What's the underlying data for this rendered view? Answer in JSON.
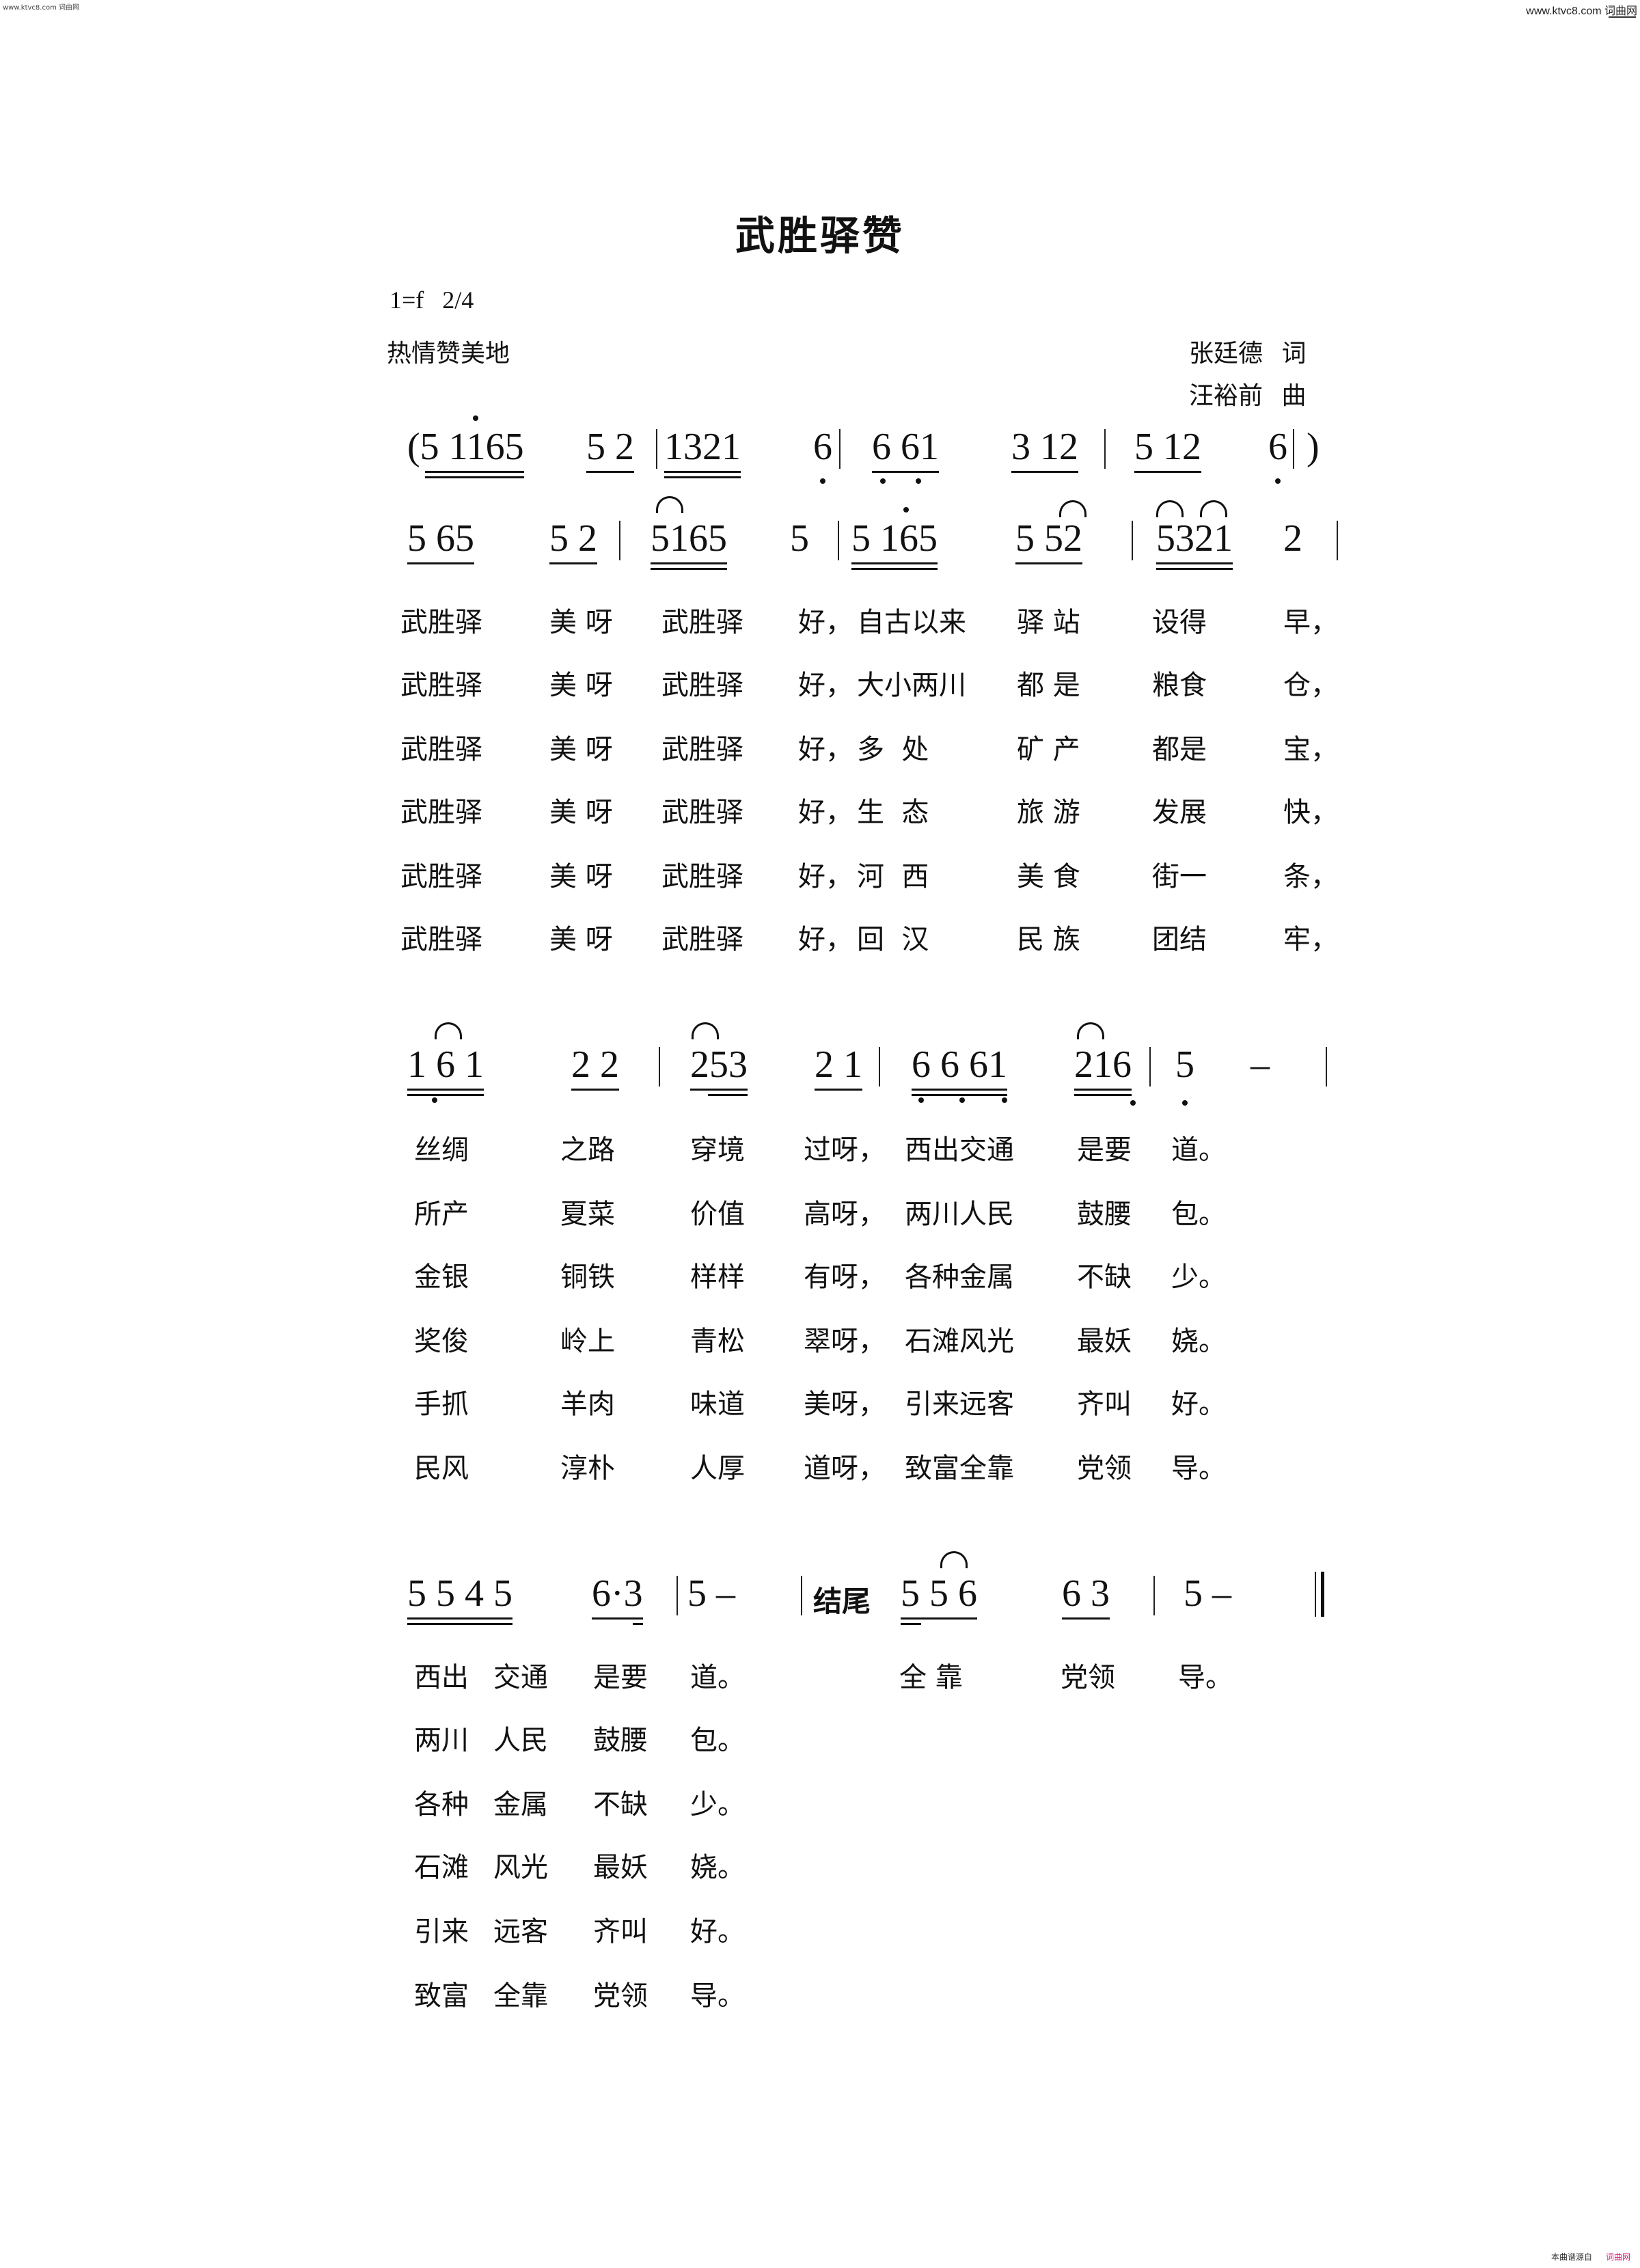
{
  "watermark": {
    "left": "www.ktvc8.com 词曲网",
    "right": "www.ktvc8.com 词曲网",
    "footer_credit": "本曲谱源自",
    "footer_site": "词曲网"
  },
  "header": {
    "title": "武胜驿赞",
    "key_signature": "1=f",
    "time_signature": "2/4",
    "expression": "热情赞美地",
    "lyricist": "张廷德",
    "lyricist_role": "词",
    "composer": "汪裕前",
    "composer_role": "曲"
  },
  "section1": {
    "intro": [
      "(5 1165",
      "5 2",
      "1321",
      "6",
      "6 61",
      "3 12",
      "5 12",
      "6",
      ")"
    ],
    "melody": [
      "5 65",
      "5 2",
      "5165",
      "5",
      "5 165",
      "5 52",
      "5321",
      "2"
    ],
    "verses": [
      [
        "武胜驿",
        "美 呀",
        "武胜驿",
        "好，",
        "自古以来",
        "驿 站",
        "设得",
        "早，"
      ],
      [
        "武胜驿",
        "美 呀",
        "武胜驿",
        "好，",
        "大小两川",
        "都 是",
        "粮食",
        "仓，"
      ],
      [
        "武胜驿",
        "美 呀",
        "武胜驿",
        "好，",
        "多  处",
        "矿 产",
        "都是",
        "宝，"
      ],
      [
        "武胜驿",
        "美 呀",
        "武胜驿",
        "好，",
        "生  态",
        "旅 游",
        "发展",
        "快，"
      ],
      [
        "武胜驿",
        "美 呀",
        "武胜驿",
        "好，",
        "河  西",
        "美 食",
        "街一",
        "条，"
      ],
      [
        "武胜驿",
        "美 呀",
        "武胜驿",
        "好，",
        "回  汉",
        "民 族",
        "团结",
        "牢，"
      ]
    ]
  },
  "section2": {
    "melody": [
      "1 6 1",
      "2 2",
      "253",
      "2 1",
      "6 6 61",
      "216",
      "5",
      "–"
    ],
    "verses": [
      [
        "丝绸",
        "之路",
        "穿境",
        "过呀，",
        "西出交通",
        "是要",
        "道。"
      ],
      [
        "所产",
        "夏菜",
        "价值",
        "高呀，",
        "两川人民",
        "鼓腰",
        "包。"
      ],
      [
        "金银",
        "铜铁",
        "样样",
        "有呀，",
        "各种金属",
        "不缺",
        "少。"
      ],
      [
        "奖俊",
        "岭上",
        "青松",
        "翠呀，",
        "石滩风光",
        "最妖",
        "娆。"
      ],
      [
        "手抓",
        "羊肉",
        "味道",
        "美呀，",
        "引来远客",
        "齐叫",
        "好。"
      ],
      [
        "民风",
        "淳朴",
        "人厚",
        "道呀，",
        "致富全靠",
        "党领",
        "导。"
      ]
    ]
  },
  "section3": {
    "melody": [
      "5 5 4 5",
      "6·3",
      "5 –"
    ],
    "ending_label": "结尾",
    "ending_melody": [
      "5 5 6",
      "6 3",
      "5 –"
    ],
    "ending_lyrics": [
      "全 靠",
      "党领",
      "导。"
    ],
    "verses": [
      [
        "西出",
        "交通",
        "是要",
        "道。"
      ],
      [
        "两川",
        "人民",
        "鼓腰",
        "包。"
      ],
      [
        "各种",
        "金属",
        "不缺",
        "少。"
      ],
      [
        "石滩",
        "风光",
        "最妖",
        "娆。"
      ],
      [
        "引来",
        "远客",
        "齐叫",
        "好。"
      ],
      [
        "致富",
        "全靠",
        "党领",
        "导。"
      ]
    ]
  }
}
